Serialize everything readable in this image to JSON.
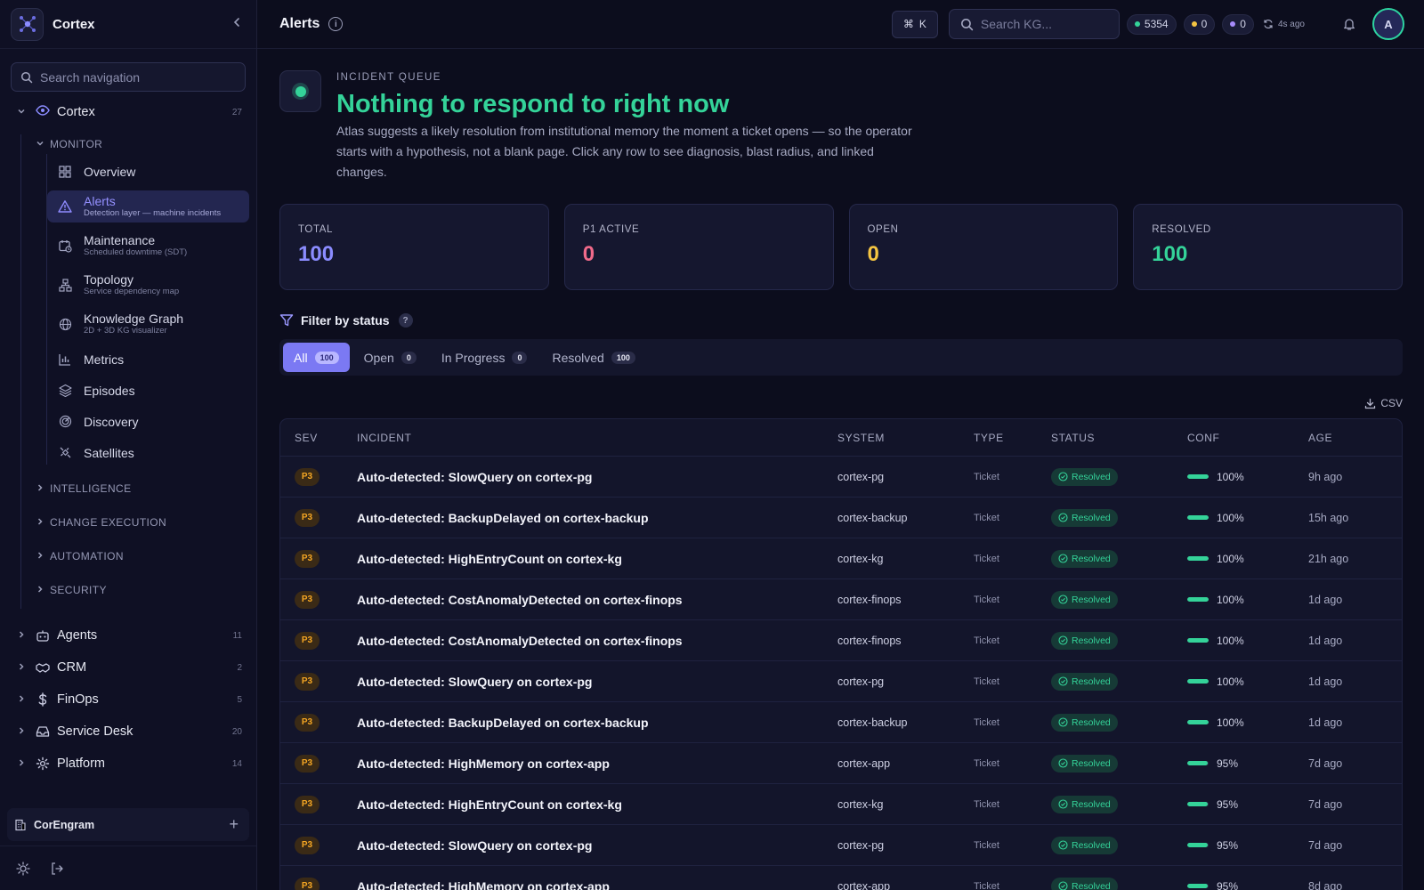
{
  "app": {
    "name": "Cortex",
    "search_placeholder": "Search navigation"
  },
  "nav": {
    "root": {
      "label": "Cortex",
      "count": "27"
    },
    "monitor": {
      "label": "MONITOR",
      "items": [
        {
          "title": "Overview",
          "desc": "",
          "icon": "grid-icon"
        },
        {
          "title": "Alerts",
          "desc": "Detection layer — machine incidents",
          "icon": "warning-icon"
        },
        {
          "title": "Maintenance",
          "desc": "Scheduled downtime (SDT)",
          "icon": "calendar-clock-icon"
        },
        {
          "title": "Topology",
          "desc": "Service dependency map",
          "icon": "network-icon"
        },
        {
          "title": "Knowledge Graph",
          "desc": "2D + 3D KG visualizer",
          "icon": "globe-icon"
        },
        {
          "title": "Metrics",
          "desc": "",
          "icon": "bar-chart-icon"
        },
        {
          "title": "Episodes",
          "desc": "",
          "icon": "layers-icon"
        },
        {
          "title": "Discovery",
          "desc": "",
          "icon": "radar-icon"
        },
        {
          "title": "Satellites",
          "desc": "",
          "icon": "satellite-icon"
        }
      ]
    },
    "groups": [
      "INTELLIGENCE",
      "CHANGE EXECUTION",
      "AUTOMATION",
      "SECURITY"
    ],
    "main": [
      {
        "label": "Agents",
        "count": "11",
        "icon": "bot-icon"
      },
      {
        "label": "CRM",
        "count": "2",
        "icon": "handshake-icon"
      },
      {
        "label": "FinOps",
        "count": "5",
        "icon": "dollar-icon"
      },
      {
        "label": "Service Desk",
        "count": "20",
        "icon": "inbox-icon"
      },
      {
        "label": "Platform",
        "count": "14",
        "icon": "gear-icon"
      }
    ],
    "org": "CorEngram"
  },
  "topbar": {
    "title": "Alerts",
    "shortcut_key": "K",
    "search_placeholder": "Search KG...",
    "pills": [
      {
        "value": "5354",
        "color": "#34d399"
      },
      {
        "value": "0",
        "color": "#f5c542"
      },
      {
        "value": "0",
        "color": "#a78bfa"
      }
    ],
    "refreshed": "4s ago",
    "avatar_initial": "A"
  },
  "hero": {
    "eyebrow": "INCIDENT QUEUE",
    "title": "Nothing to respond to right now",
    "description": "Atlas suggests a likely resolution from institutional memory the moment a ticket opens — so the operator starts with a hypothesis, not a blank page. Click any row to see diagnosis, blast radius, and linked changes."
  },
  "stats": [
    {
      "label": "TOTAL",
      "value": "100",
      "color": "#8b8cff"
    },
    {
      "label": "P1 ACTIVE",
      "value": "0",
      "color": "#f06a8a"
    },
    {
      "label": "OPEN",
      "value": "0",
      "color": "#f5c542"
    },
    {
      "label": "RESOLVED",
      "value": "100",
      "color": "#34d399"
    }
  ],
  "filter": {
    "label": "Filter by status",
    "help": "?",
    "tabs": [
      {
        "label": "All",
        "count": "100",
        "active": true
      },
      {
        "label": "Open",
        "count": "0",
        "active": false
      },
      {
        "label": "In Progress",
        "count": "0",
        "active": false
      },
      {
        "label": "Resolved",
        "count": "100",
        "active": false
      }
    ]
  },
  "export": {
    "label": "CSV"
  },
  "table": {
    "headers": {
      "sev": "SEV",
      "incident": "INCIDENT",
      "system": "SYSTEM",
      "type": "TYPE",
      "status": "STATUS",
      "conf": "CONF",
      "age": "AGE"
    },
    "rows": [
      {
        "sev": "P3",
        "incident": "Auto-detected: SlowQuery on cortex-pg",
        "system": "cortex-pg",
        "type": "Ticket",
        "status": "Resolved",
        "conf": "100%",
        "conf_value": 1.0,
        "age": "9h ago"
      },
      {
        "sev": "P3",
        "incident": "Auto-detected: BackupDelayed on cortex-backup",
        "system": "cortex-backup",
        "type": "Ticket",
        "status": "Resolved",
        "conf": "100%",
        "conf_value": 1.0,
        "age": "15h ago"
      },
      {
        "sev": "P3",
        "incident": "Auto-detected: HighEntryCount on cortex-kg",
        "system": "cortex-kg",
        "type": "Ticket",
        "status": "Resolved",
        "conf": "100%",
        "conf_value": 1.0,
        "age": "21h ago"
      },
      {
        "sev": "P3",
        "incident": "Auto-detected: CostAnomalyDetected on cortex-finops",
        "system": "cortex-finops",
        "type": "Ticket",
        "status": "Resolved",
        "conf": "100%",
        "conf_value": 1.0,
        "age": "1d ago"
      },
      {
        "sev": "P3",
        "incident": "Auto-detected: CostAnomalyDetected on cortex-finops",
        "system": "cortex-finops",
        "type": "Ticket",
        "status": "Resolved",
        "conf": "100%",
        "conf_value": 1.0,
        "age": "1d ago"
      },
      {
        "sev": "P3",
        "incident": "Auto-detected: SlowQuery on cortex-pg",
        "system": "cortex-pg",
        "type": "Ticket",
        "status": "Resolved",
        "conf": "100%",
        "conf_value": 1.0,
        "age": "1d ago"
      },
      {
        "sev": "P3",
        "incident": "Auto-detected: BackupDelayed on cortex-backup",
        "system": "cortex-backup",
        "type": "Ticket",
        "status": "Resolved",
        "conf": "100%",
        "conf_value": 1.0,
        "age": "1d ago"
      },
      {
        "sev": "P3",
        "incident": "Auto-detected: HighMemory on cortex-app",
        "system": "cortex-app",
        "type": "Ticket",
        "status": "Resolved",
        "conf": "95%",
        "conf_value": 0.95,
        "age": "7d ago"
      },
      {
        "sev": "P3",
        "incident": "Auto-detected: HighEntryCount on cortex-kg",
        "system": "cortex-kg",
        "type": "Ticket",
        "status": "Resolved",
        "conf": "95%",
        "conf_value": 0.95,
        "age": "7d ago"
      },
      {
        "sev": "P3",
        "incident": "Auto-detected: SlowQuery on cortex-pg",
        "system": "cortex-pg",
        "type": "Ticket",
        "status": "Resolved",
        "conf": "95%",
        "conf_value": 0.95,
        "age": "7d ago"
      },
      {
        "sev": "P3",
        "incident": "Auto-detected: HighMemory on cortex-app",
        "system": "cortex-app",
        "type": "Ticket",
        "status": "Resolved",
        "conf": "95%",
        "conf_value": 0.95,
        "age": "8d ago"
      }
    ]
  }
}
